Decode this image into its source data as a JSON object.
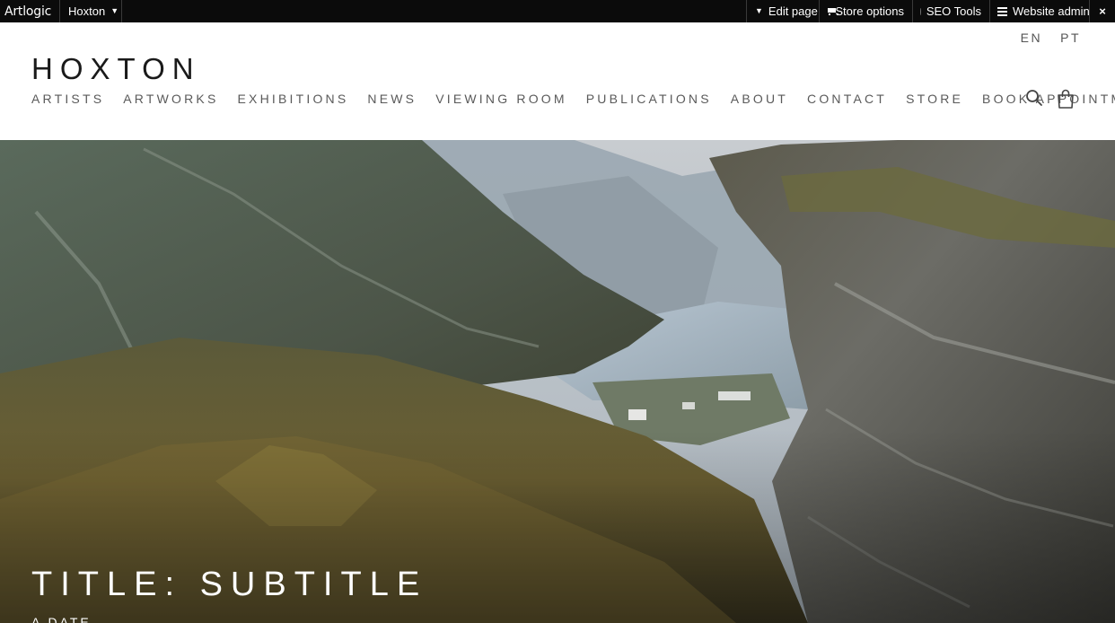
{
  "adminbar": {
    "logo": "Artlogic",
    "site": "Hoxton",
    "edit_page": "Edit page",
    "store_options": "Store options",
    "seo_tools": "SEO Tools",
    "website_admin": "Website admin",
    "close": "×"
  },
  "header": {
    "languages": [
      "EN",
      "PT"
    ],
    "brand": "HOXTON",
    "nav": [
      "ARTISTS",
      "ARTWORKS",
      "EXHIBITIONS",
      "NEWS",
      "VIEWING ROOM",
      "PUBLICATIONS",
      "ABOUT",
      "CONTACT",
      "STORE",
      "BOOK APPOINTMENT"
    ]
  },
  "hero": {
    "title": "TITLE: SUBTITLE",
    "date": "A DATE"
  },
  "colors": {
    "adminbar_bg": "#0b0b0b",
    "nav_text": "#5a5a5a",
    "brand_text": "#1a1a1a"
  },
  "icons": [
    "caret-down-icon",
    "cart-icon",
    "status-dot-icon",
    "menu-icon",
    "close-icon",
    "search-icon",
    "shopping-bag-icon"
  ]
}
